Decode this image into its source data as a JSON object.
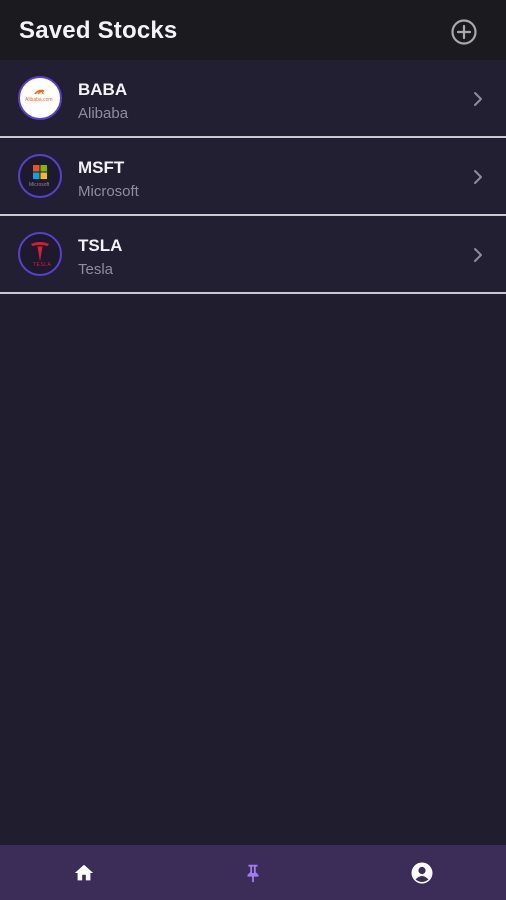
{
  "header": {
    "title": "Saved Stocks",
    "add_icon": "plus-circle-icon"
  },
  "stocks": [
    {
      "ticker": "BABA",
      "name": "Alibaba",
      "logo_text": "Alibaba.com",
      "logo_icon": "alibaba-logo",
      "chevron_icon": "chevron-right-icon"
    },
    {
      "ticker": "MSFT",
      "name": "Microsoft",
      "logo_text": "Microsoft",
      "logo_icon": "microsoft-logo",
      "chevron_icon": "chevron-right-icon"
    },
    {
      "ticker": "TSLA",
      "name": "Tesla",
      "logo_text": "TESLA",
      "logo_icon": "tesla-logo",
      "chevron_icon": "chevron-right-icon"
    }
  ],
  "bottom_nav": {
    "items": [
      {
        "icon": "home-icon",
        "active": false
      },
      {
        "icon": "pin-icon",
        "active": true
      },
      {
        "icon": "account-icon",
        "active": false
      }
    ]
  },
  "colors": {
    "background": "#201d2f",
    "header": "#1b1a1f",
    "row": "#221f33",
    "nav": "#3b2d57",
    "accent": "#a07cf2",
    "logo_border": "#5b3fd1",
    "subtext": "#8e8ca0"
  }
}
